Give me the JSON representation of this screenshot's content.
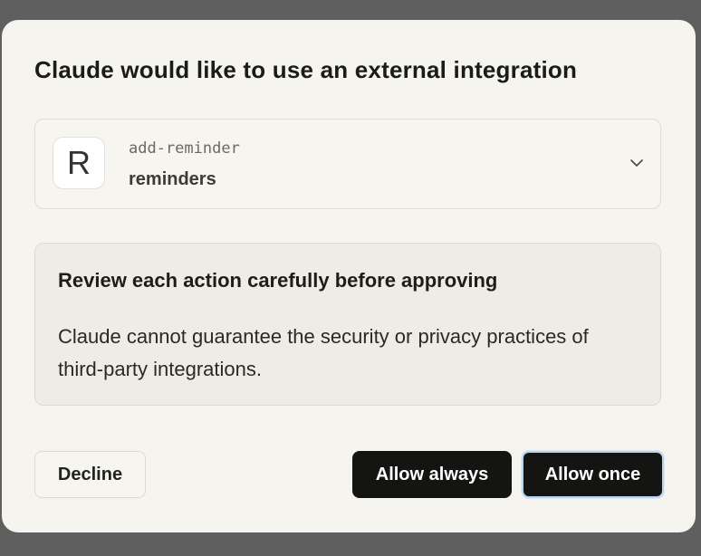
{
  "dialog": {
    "title": "Claude would like to use an external integration"
  },
  "tool": {
    "avatar_letter": "R",
    "name": "add-reminder",
    "server": "reminders",
    "expand_icon": "chevron-down-icon"
  },
  "warning": {
    "title": "Review each action carefully before approving",
    "body": "Claude cannot guarantee the security or privacy practices of third-party integrations."
  },
  "buttons": {
    "decline": "Decline",
    "allow_always": "Allow always",
    "allow_once": "Allow once"
  },
  "colors": {
    "dialog_background": "#f5f4ee",
    "overlay": "#5f5f5f",
    "primary_button": "#141413",
    "focus_ring": "#b9d4f1"
  }
}
